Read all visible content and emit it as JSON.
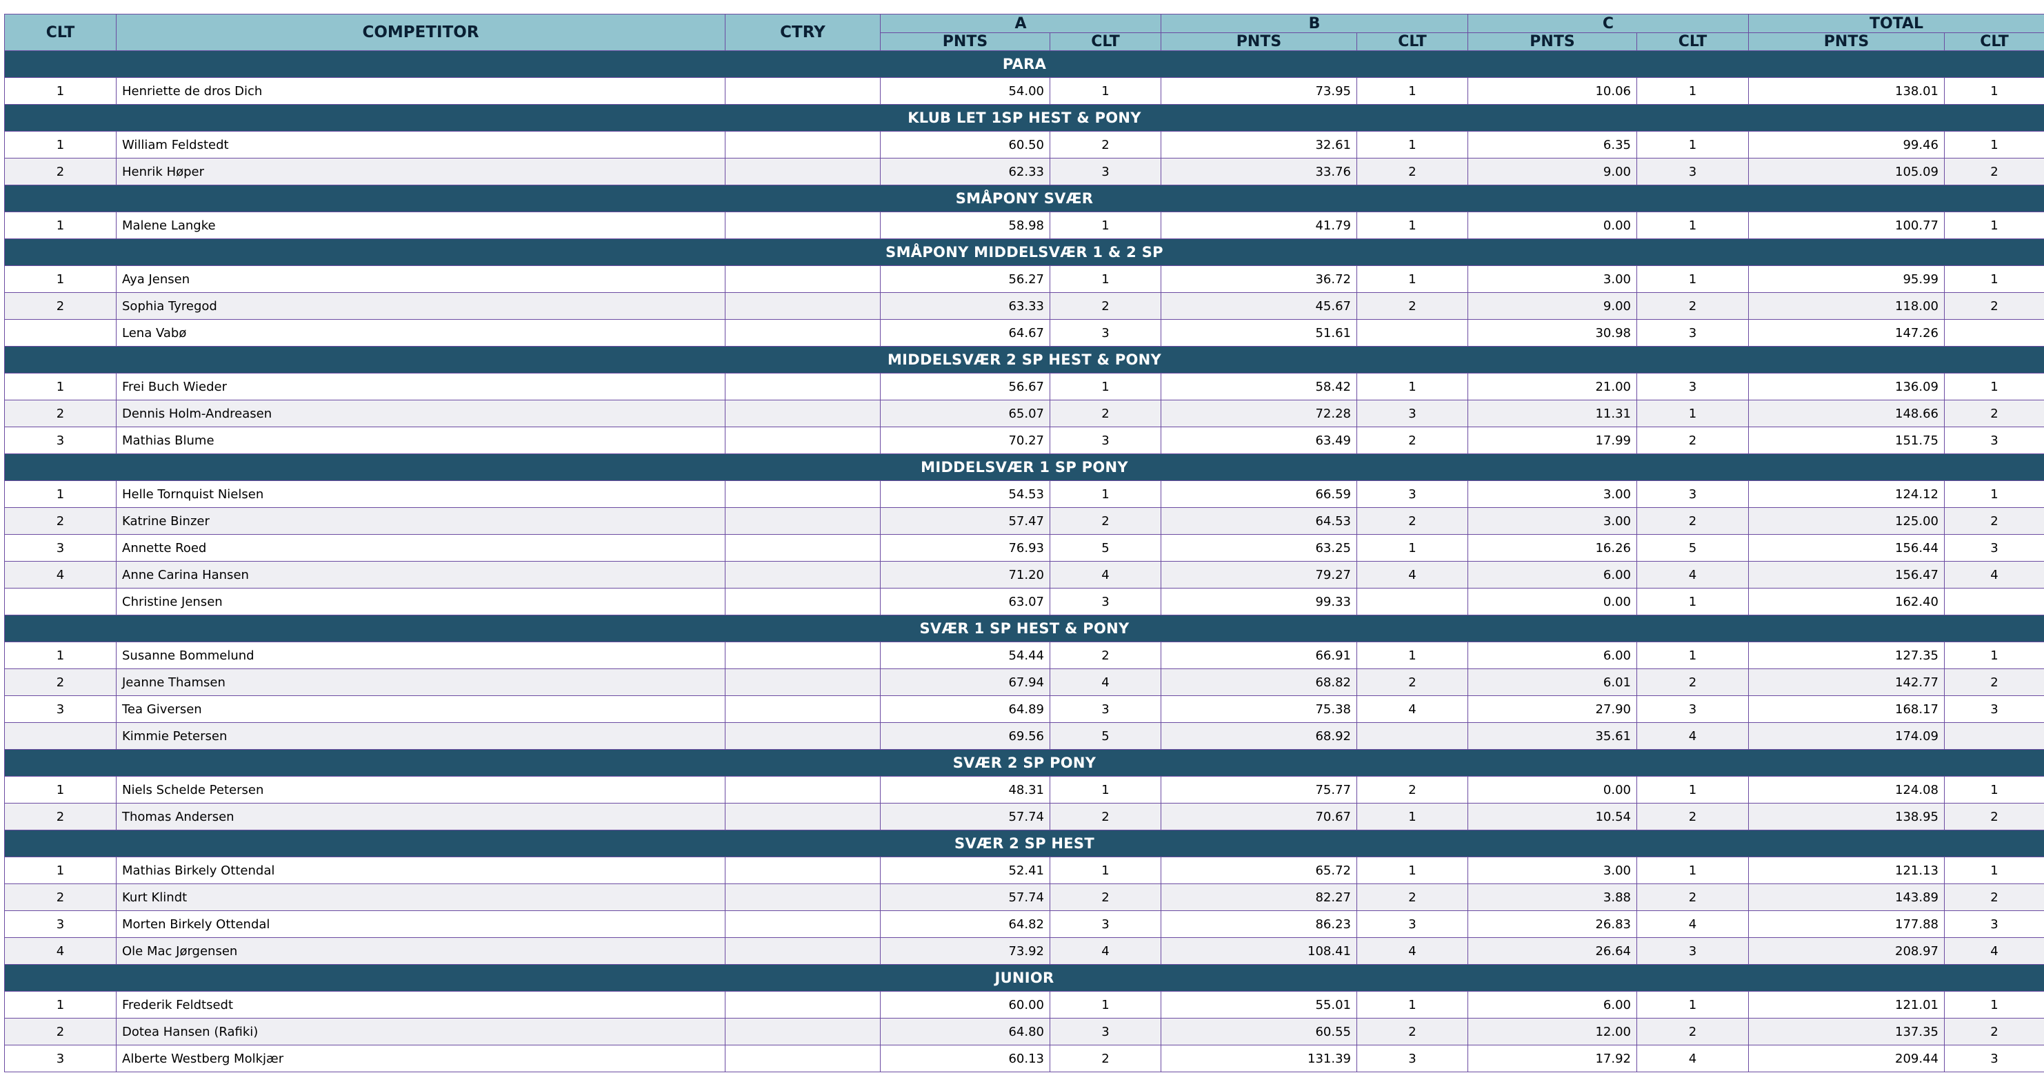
{
  "columns": {
    "clt": "CLT",
    "competitor": "COMPETITOR",
    "ctry": "CTRY",
    "group_a": "A",
    "group_b": "B",
    "group_c": "C",
    "group_total": "TOTAL",
    "pnts": "PNTS",
    "sub_clt": "CLT"
  },
  "colors": {
    "header_bg": "#92c4cf",
    "category_bg": "#23536c",
    "grid": "#6b4ba1",
    "row_alt": "#efeff3"
  },
  "categories": [
    {
      "name": "PARA",
      "rows": [
        {
          "clt": "1",
          "name": "Henriette de dros Dich",
          "ctry": "",
          "a_pnts": "54.00",
          "a_clt": "1",
          "b_pnts": "73.95",
          "b_clt": "1",
          "c_pnts": "10.06",
          "c_clt": "1",
          "t_pnts": "138.01",
          "t_clt": "1"
        }
      ]
    },
    {
      "name": "KLUB LET 1SP HEST & PONY",
      "rows": [
        {
          "clt": "1",
          "name": "William Feldstedt",
          "ctry": "",
          "a_pnts": "60.50",
          "a_clt": "2",
          "b_pnts": "32.61",
          "b_clt": "1",
          "c_pnts": "6.35",
          "c_clt": "1",
          "t_pnts": "99.46",
          "t_clt": "1"
        },
        {
          "clt": "2",
          "name": "Henrik Høper",
          "ctry": "",
          "a_pnts": "62.33",
          "a_clt": "3",
          "b_pnts": "33.76",
          "b_clt": "2",
          "c_pnts": "9.00",
          "c_clt": "3",
          "t_pnts": "105.09",
          "t_clt": "2"
        }
      ]
    },
    {
      "name": "SMÅPONY SVÆR",
      "rows": [
        {
          "clt": "1",
          "name": "Malene Langke",
          "ctry": "",
          "a_pnts": "58.98",
          "a_clt": "1",
          "b_pnts": "41.79",
          "b_clt": "1",
          "c_pnts": "0.00",
          "c_clt": "1",
          "t_pnts": "100.77",
          "t_clt": "1"
        }
      ]
    },
    {
      "name": "SMÅPONY MIDDELSVÆR 1 & 2 SP",
      "rows": [
        {
          "clt": "1",
          "name": "Aya Jensen",
          "ctry": "",
          "a_pnts": "56.27",
          "a_clt": "1",
          "b_pnts": "36.72",
          "b_clt": "1",
          "c_pnts": "3.00",
          "c_clt": "1",
          "t_pnts": "95.99",
          "t_clt": "1"
        },
        {
          "clt": "2",
          "name": "Sophia Tyregod",
          "ctry": "",
          "a_pnts": "63.33",
          "a_clt": "2",
          "b_pnts": "45.67",
          "b_clt": "2",
          "c_pnts": "9.00",
          "c_clt": "2",
          "t_pnts": "118.00",
          "t_clt": "2"
        },
        {
          "clt": "",
          "name": "Lena Vabø",
          "ctry": "",
          "a_pnts": "64.67",
          "a_clt": "3",
          "b_pnts": "51.61",
          "b_clt": "",
          "c_pnts": "30.98",
          "c_clt": "3",
          "t_pnts": "147.26",
          "t_clt": ""
        }
      ]
    },
    {
      "name": "MIDDELSVÆR 2 SP HEST & PONY",
      "rows": [
        {
          "clt": "1",
          "name": "Frei Buch Wieder",
          "ctry": "",
          "a_pnts": "56.67",
          "a_clt": "1",
          "b_pnts": "58.42",
          "b_clt": "1",
          "c_pnts": "21.00",
          "c_clt": "3",
          "t_pnts": "136.09",
          "t_clt": "1"
        },
        {
          "clt": "2",
          "name": "Dennis Holm-Andreasen",
          "ctry": "",
          "a_pnts": "65.07",
          "a_clt": "2",
          "b_pnts": "72.28",
          "b_clt": "3",
          "c_pnts": "11.31",
          "c_clt": "1",
          "t_pnts": "148.66",
          "t_clt": "2"
        },
        {
          "clt": "3",
          "name": "Mathias Blume",
          "ctry": "",
          "a_pnts": "70.27",
          "a_clt": "3",
          "b_pnts": "63.49",
          "b_clt": "2",
          "c_pnts": "17.99",
          "c_clt": "2",
          "t_pnts": "151.75",
          "t_clt": "3"
        }
      ]
    },
    {
      "name": "MIDDELSVÆR 1 SP PONY",
      "rows": [
        {
          "clt": "1",
          "name": "Helle Tornquist Nielsen",
          "ctry": "",
          "a_pnts": "54.53",
          "a_clt": "1",
          "b_pnts": "66.59",
          "b_clt": "3",
          "c_pnts": "3.00",
          "c_clt": "3",
          "t_pnts": "124.12",
          "t_clt": "1"
        },
        {
          "clt": "2",
          "name": "Katrine Binzer",
          "ctry": "",
          "a_pnts": "57.47",
          "a_clt": "2",
          "b_pnts": "64.53",
          "b_clt": "2",
          "c_pnts": "3.00",
          "c_clt": "2",
          "t_pnts": "125.00",
          "t_clt": "2"
        },
        {
          "clt": "3",
          "name": "Annette Roed",
          "ctry": "",
          "a_pnts": "76.93",
          "a_clt": "5",
          "b_pnts": "63.25",
          "b_clt": "1",
          "c_pnts": "16.26",
          "c_clt": "5",
          "t_pnts": "156.44",
          "t_clt": "3"
        },
        {
          "clt": "4",
          "name": "Anne Carina Hansen",
          "ctry": "",
          "a_pnts": "71.20",
          "a_clt": "4",
          "b_pnts": "79.27",
          "b_clt": "4",
          "c_pnts": "6.00",
          "c_clt": "4",
          "t_pnts": "156.47",
          "t_clt": "4"
        },
        {
          "clt": "",
          "name": "Christine Jensen",
          "ctry": "",
          "a_pnts": "63.07",
          "a_clt": "3",
          "b_pnts": "99.33",
          "b_clt": "",
          "c_pnts": "0.00",
          "c_clt": "1",
          "t_pnts": "162.40",
          "t_clt": ""
        }
      ]
    },
    {
      "name": "SVÆR 1 SP HEST & PONY",
      "rows": [
        {
          "clt": "1",
          "name": "Susanne Bommelund",
          "ctry": "",
          "a_pnts": "54.44",
          "a_clt": "2",
          "b_pnts": "66.91",
          "b_clt": "1",
          "c_pnts": "6.00",
          "c_clt": "1",
          "t_pnts": "127.35",
          "t_clt": "1"
        },
        {
          "clt": "2",
          "name": "Jeanne Thamsen",
          "ctry": "",
          "a_pnts": "67.94",
          "a_clt": "4",
          "b_pnts": "68.82",
          "b_clt": "2",
          "c_pnts": "6.01",
          "c_clt": "2",
          "t_pnts": "142.77",
          "t_clt": "2"
        },
        {
          "clt": "3",
          "name": "Tea Giversen",
          "ctry": "",
          "a_pnts": "64.89",
          "a_clt": "3",
          "b_pnts": "75.38",
          "b_clt": "4",
          "c_pnts": "27.90",
          "c_clt": "3",
          "t_pnts": "168.17",
          "t_clt": "3"
        },
        {
          "clt": "",
          "name": "Kimmie Petersen",
          "ctry": "",
          "a_pnts": "69.56",
          "a_clt": "5",
          "b_pnts": "68.92",
          "b_clt": "",
          "c_pnts": "35.61",
          "c_clt": "4",
          "t_pnts": "174.09",
          "t_clt": ""
        }
      ]
    },
    {
      "name": "SVÆR 2 SP PONY",
      "rows": [
        {
          "clt": "1",
          "name": "Niels Schelde Petersen",
          "ctry": "",
          "a_pnts": "48.31",
          "a_clt": "1",
          "b_pnts": "75.77",
          "b_clt": "2",
          "c_pnts": "0.00",
          "c_clt": "1",
          "t_pnts": "124.08",
          "t_clt": "1"
        },
        {
          "clt": "2",
          "name": "Thomas Andersen",
          "ctry": "",
          "a_pnts": "57.74",
          "a_clt": "2",
          "b_pnts": "70.67",
          "b_clt": "1",
          "c_pnts": "10.54",
          "c_clt": "2",
          "t_pnts": "138.95",
          "t_clt": "2"
        }
      ]
    },
    {
      "name": "SVÆR 2 SP HEST",
      "rows": [
        {
          "clt": "1",
          "name": "Mathias Birkely Ottendal",
          "ctry": "",
          "a_pnts": "52.41",
          "a_clt": "1",
          "b_pnts": "65.72",
          "b_clt": "1",
          "c_pnts": "3.00",
          "c_clt": "1",
          "t_pnts": "121.13",
          "t_clt": "1"
        },
        {
          "clt": "2",
          "name": "Kurt Klindt",
          "ctry": "",
          "a_pnts": "57.74",
          "a_clt": "2",
          "b_pnts": "82.27",
          "b_clt": "2",
          "c_pnts": "3.88",
          "c_clt": "2",
          "t_pnts": "143.89",
          "t_clt": "2"
        },
        {
          "clt": "3",
          "name": "Morten Birkely Ottendal",
          "ctry": "",
          "a_pnts": "64.82",
          "a_clt": "3",
          "b_pnts": "86.23",
          "b_clt": "3",
          "c_pnts": "26.83",
          "c_clt": "4",
          "t_pnts": "177.88",
          "t_clt": "3"
        },
        {
          "clt": "4",
          "name": "Ole Mac Jørgensen",
          "ctry": "",
          "a_pnts": "73.92",
          "a_clt": "4",
          "b_pnts": "108.41",
          "b_clt": "4",
          "c_pnts": "26.64",
          "c_clt": "3",
          "t_pnts": "208.97",
          "t_clt": "4"
        }
      ]
    },
    {
      "name": "JUNIOR",
      "rows": [
        {
          "clt": "1",
          "name": "Frederik Feldtsedt",
          "ctry": "",
          "a_pnts": "60.00",
          "a_clt": "1",
          "b_pnts": "55.01",
          "b_clt": "1",
          "c_pnts": "6.00",
          "c_clt": "1",
          "t_pnts": "121.01",
          "t_clt": "1"
        },
        {
          "clt": "2",
          "name": "Dotea Hansen (Rafiki)",
          "ctry": "",
          "a_pnts": "64.80",
          "a_clt": "3",
          "b_pnts": "60.55",
          "b_clt": "2",
          "c_pnts": "12.00",
          "c_clt": "2",
          "t_pnts": "137.35",
          "t_clt": "2"
        },
        {
          "clt": "3",
          "name": "Alberte Westberg Molkjær",
          "ctry": "",
          "a_pnts": "60.13",
          "a_clt": "2",
          "b_pnts": "131.39",
          "b_clt": "3",
          "c_pnts": "17.92",
          "c_clt": "4",
          "t_pnts": "209.44",
          "t_clt": "3"
        }
      ]
    }
  ]
}
